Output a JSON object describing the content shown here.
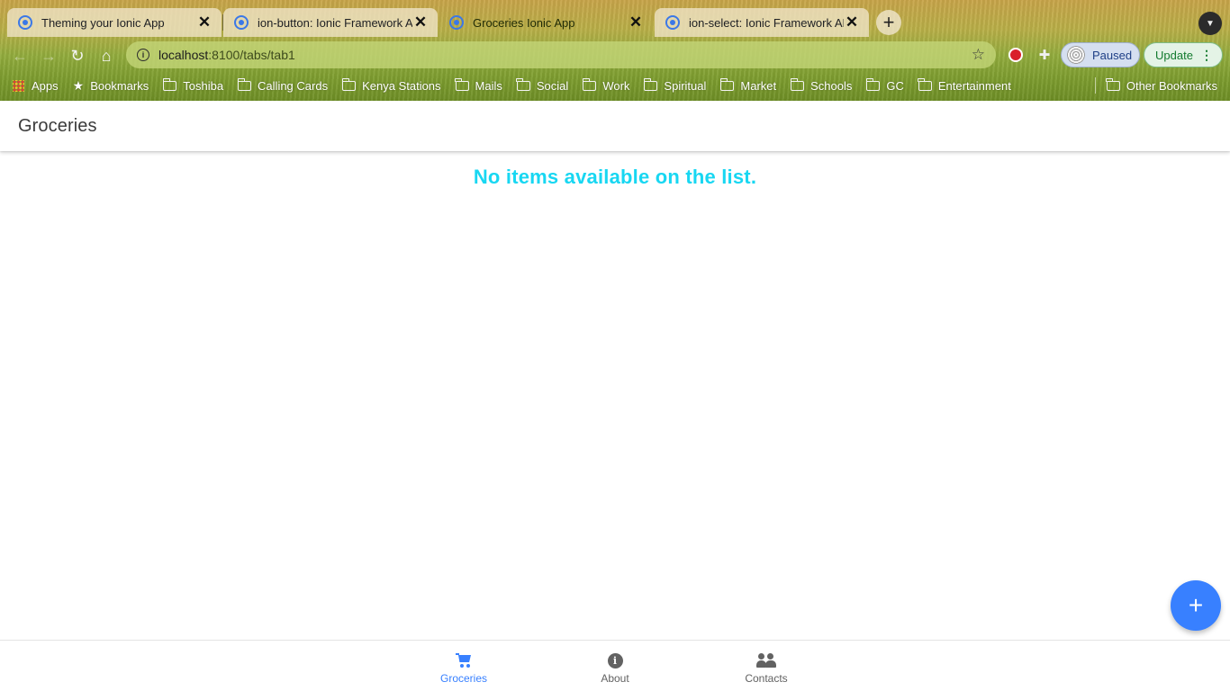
{
  "browser": {
    "tabs": [
      {
        "title": "Theming your Ionic App",
        "active": false
      },
      {
        "title": "ion-button: Ionic Framework API",
        "active": false
      },
      {
        "title": "Groceries Ionic App",
        "active": true
      },
      {
        "title": "ion-select: Ionic Framework API",
        "active": false
      }
    ],
    "new_tab_symbol": "+",
    "url_host": "localhost",
    "url_rest": ":8100/tabs/tab1",
    "profile_label": "Paused",
    "update_label": "Update",
    "bookmarks": [
      {
        "label": "Apps",
        "icon": "apps-grid-icon"
      },
      {
        "label": "Bookmarks",
        "icon": "star-icon"
      },
      {
        "label": "Toshiba",
        "icon": "folder-icon"
      },
      {
        "label": "Calling Cards",
        "icon": "folder-icon"
      },
      {
        "label": "Kenya Stations",
        "icon": "folder-icon"
      },
      {
        "label": "Mails",
        "icon": "folder-icon"
      },
      {
        "label": "Social",
        "icon": "folder-icon"
      },
      {
        "label": "Work",
        "icon": "folder-icon"
      },
      {
        "label": "Spiritual",
        "icon": "folder-icon"
      },
      {
        "label": "Market",
        "icon": "folder-icon"
      },
      {
        "label": "Schools",
        "icon": "folder-icon"
      },
      {
        "label": "GC",
        "icon": "folder-icon"
      },
      {
        "label": "Entertainment",
        "icon": "folder-icon"
      }
    ],
    "other_bookmarks": "Other Bookmarks"
  },
  "app": {
    "title": "Groceries",
    "empty_message": "No items available on the list.",
    "fab_symbol": "+",
    "tabs": [
      {
        "label": "Groceries",
        "icon": "cart-icon",
        "selected": true
      },
      {
        "label": "About",
        "icon": "information-circle-icon",
        "selected": false
      },
      {
        "label": "Contacts",
        "icon": "people-icon",
        "selected": false
      }
    ]
  },
  "colors": {
    "primary": "#3880ff",
    "empty_message": "#18d7f2",
    "tab_inactive": "#626262"
  }
}
